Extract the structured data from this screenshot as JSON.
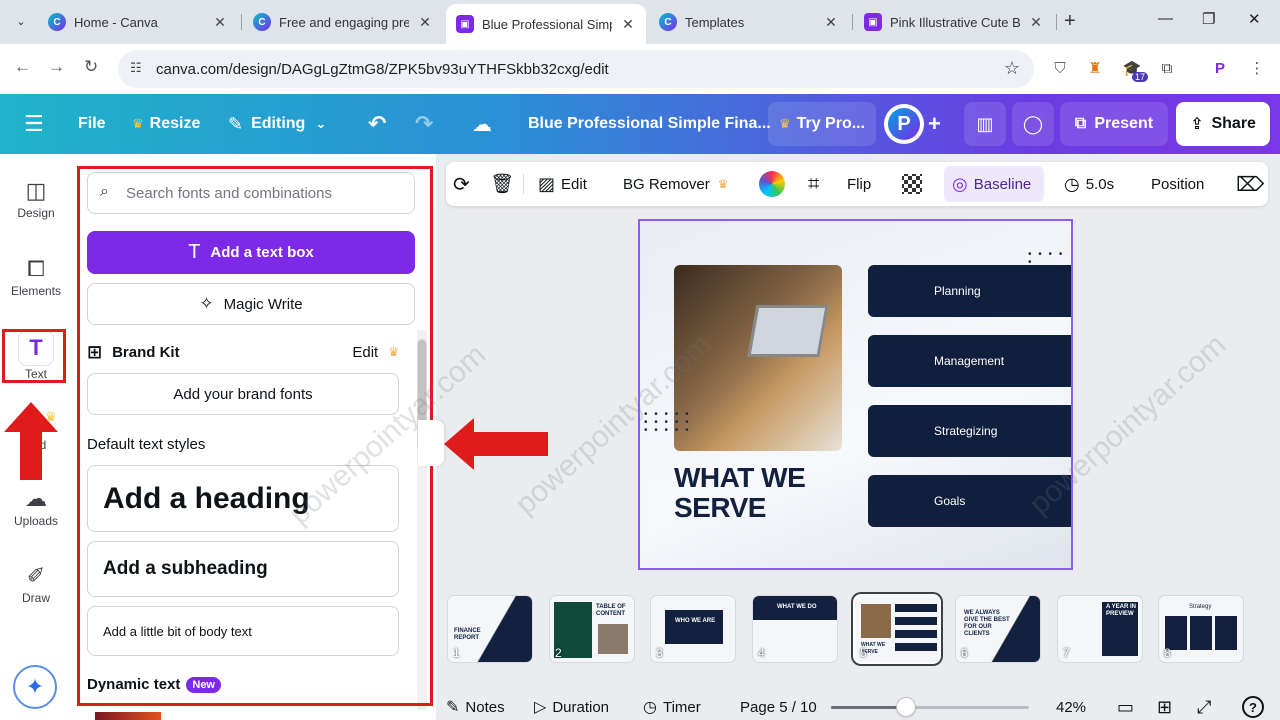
{
  "browser": {
    "tabs": [
      {
        "title": "Home - Canva",
        "favicon": "canva-icon"
      },
      {
        "title": "Free and engaging prese",
        "favicon": "canva-icon"
      },
      {
        "title": "Blue Professional Simple",
        "favicon": "canva-present-icon",
        "active": true
      },
      {
        "title": "Templates",
        "favicon": "canva-icon"
      },
      {
        "title": "Pink Illustrative Cute Bra",
        "favicon": "canva-present-icon"
      }
    ],
    "url": "canva.com/design/DAGgLgZtmG8/ZPK5bv93uYTHFSkbb32cxg/edit",
    "extension_badge": "17"
  },
  "header": {
    "file": "File",
    "resize": "Resize",
    "editing": "Editing",
    "doc_title": "Blue Professional Simple Fina...",
    "try_pro": "Try Pro...",
    "avatar_letter": "P",
    "present": "Present",
    "share": "Share"
  },
  "rail": {
    "items": [
      {
        "label": "Design",
        "icon": "layout-icon"
      },
      {
        "label": "Elements",
        "icon": "shapes-icon"
      },
      {
        "label": "Text",
        "icon": "text-icon",
        "active": true
      },
      {
        "label": "d",
        "icon": "brand-icon"
      },
      {
        "label": "Uploads",
        "icon": "upload-cloud-icon"
      },
      {
        "label": "Draw",
        "icon": "pen-icon"
      }
    ]
  },
  "text_panel": {
    "search_placeholder": "Search fonts and combinations",
    "add_text_box": "Add a text box",
    "magic_write": "Magic Write",
    "brand_kit": "Brand Kit",
    "brand_kit_edit": "Edit",
    "add_brand_fonts": "Add your brand fonts",
    "default_styles_label": "Default text styles",
    "heading": "Add a heading",
    "subheading": "Add a subheading",
    "body": "Add a little bit of body text",
    "dynamic_text": "Dynamic text",
    "new_badge": "New"
  },
  "context_toolbar": {
    "edit": "Edit",
    "bg_remover": "BG Remover",
    "flip": "Flip",
    "baseline": "Baseline",
    "duration": "5.0s",
    "position": "Position"
  },
  "slide": {
    "title_line1": "WHAT WE",
    "title_line2": "SERVE",
    "services": [
      "Planning",
      "Management",
      "Strategizing",
      "Goals"
    ],
    "watermark": "powerpointyar.com"
  },
  "thumbnails": [
    {
      "num": "1",
      "text": "FINANCE REPORT"
    },
    {
      "num": "2",
      "text": "TABLE OF CONTENT"
    },
    {
      "num": "3",
      "text": "WHO WE ARE"
    },
    {
      "num": "4",
      "text": "WHAT WE DO"
    },
    {
      "num": "5",
      "text": "WHAT WE SERVE",
      "active": true
    },
    {
      "num": "6",
      "text": "WE ALWAYS GIVE THE BEST FOR OUR CLIENTS"
    },
    {
      "num": "7",
      "text": "A YEAR IN PREVIEW"
    },
    {
      "num": "8",
      "text": "Strategy"
    }
  ],
  "footer": {
    "notes": "Notes",
    "duration": "Duration",
    "timer": "Timer",
    "page": "Page 5 / 10",
    "zoom": "42%",
    "zoom_fraction": 0.38
  },
  "colors": {
    "accent": "#7d2ae8",
    "annotation_red": "#e01b1b",
    "slide_navy": "#0f1f3d"
  }
}
